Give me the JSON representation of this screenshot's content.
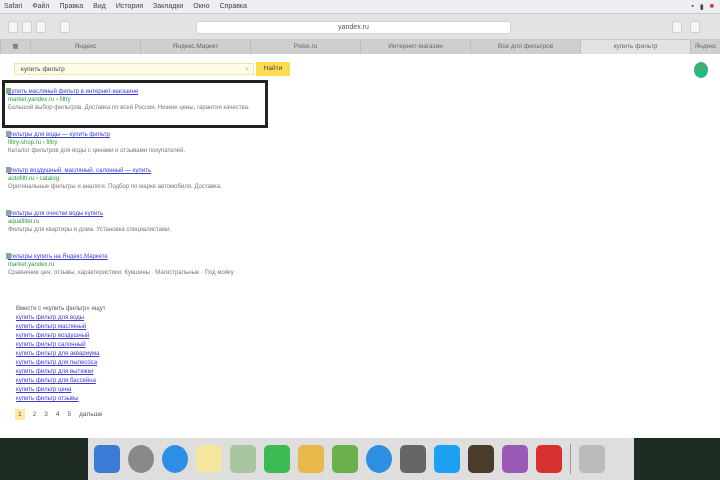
{
  "menubar": {
    "items": [
      "Safari",
      "Файл",
      "Правка",
      "Вид",
      "История",
      "Закладки",
      "Окно",
      "Справка"
    ]
  },
  "toolbar": {
    "url": "yandex.ru"
  },
  "tabs": [
    "Яндекс",
    "Яндекс.Маркет",
    "Poisk.ru",
    "Интернет-магазин",
    "Все для фильтров",
    "купить фильтр",
    "Яндекс"
  ],
  "search": {
    "query": "купить фильтр",
    "clear": "×",
    "button": "Найти"
  },
  "results": [
    {
      "title": "Купить масляный фильтр в интернет-магазине",
      "url": "market.yandex.ru › filtry",
      "desc": "Большой выбор фильтров. Доставка по всей России. Низкие цены, гарантия качества."
    },
    {
      "title": "Фильтры для воды — купить фильтр",
      "url": "filtry-shop.ru › filtry",
      "desc": "Каталог фильтров для воды с ценами и отзывами покупателей."
    },
    {
      "title": "Фильтр воздушный, масляный, салонный — купить",
      "url": "autofiltr.ru › catalog",
      "desc": "Оригинальные фильтры и аналоги. Подбор по марке автомобиля. Доставка."
    },
    {
      "title": "Фильтры для очистки воды купить",
      "url": "aquafilter.ru",
      "desc": "Фильтры для квартиры и дома. Установка специалистами."
    },
    {
      "title": "Фильтры купить на Яндекс.Маркете",
      "url": "market.yandex.ru",
      "desc": "Сравнение цен, отзывы, характеристики. Кувшины · Магистральные · Под мойку"
    }
  ],
  "related": {
    "heading": "Вместе с «купить фильтр» ищут",
    "links": [
      "купить фильтр для воды",
      "купить фильтр масляный",
      "купить фильтр воздушный",
      "купить фильтр салонный",
      "купить фильтр для аквариума",
      "купить фильтр для пылесоса",
      "купить фильтр для вытяжки",
      "купить фильтр для бассейна",
      "купить фильтр цена",
      "купить фильтр отзывы"
    ]
  },
  "pager": {
    "pages": [
      "1",
      "2",
      "3",
      "4",
      "5"
    ],
    "next": "дальше"
  }
}
